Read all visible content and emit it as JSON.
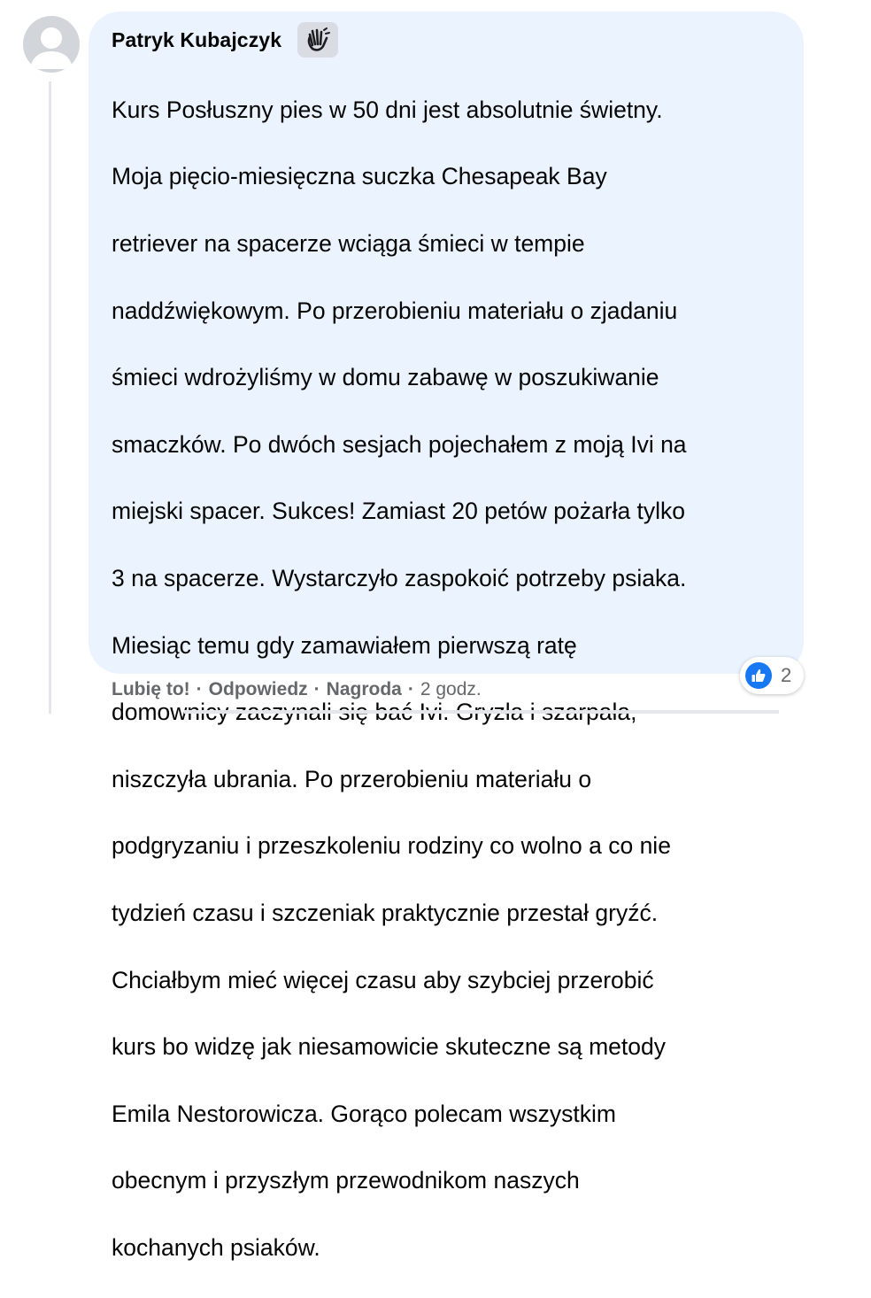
{
  "comment": {
    "author": "Patryk Kubajczyk",
    "badge_icon": "waving-hand-icon",
    "lines": [
      "Kurs Posłuszny pies w 50 dni jest absolutnie świetny.",
      "Moja pięcio-miesięczna suczka Chesapeak Bay",
      "retriever na spacerze wciąga śmieci w tempie",
      "naddźwiękowym. Po przerobieniu materiału o zjadaniu",
      "śmieci wdrożyliśmy w domu zabawę w poszukiwanie",
      "smaczków. Po dwóch sesjach pojechałem z moją Ivi na",
      "miejski spacer. Sukces! Zamiast 20 petów pożarła tylko",
      "3 na spacerze. Wystarczyło zaspokoić potrzeby psiaka.",
      "Miesiąc temu gdy zamawiałem pierwszą ratę",
      "domownicy zaczynali się bać Ivi. Gryzła i szarpała,",
      "niszczyła ubrania. Po przerobieniu materiału o",
      "podgryzaniu i przeszkoleniu rodziny co wolno a co nie",
      "tydzień czasu i szczeniak praktycznie przestał gryźć.",
      "Chciałbym mieć więcej czasu aby szybciej przerobić",
      "kurs bo widzę jak niesamowicie skuteczne są metody",
      "Emila Nestorowicza. Gorąco polecam wszystkim",
      "obecnym i przyszłym przewodnikom naszych",
      "kochanych psiaków."
    ],
    "actions": {
      "like": "Lubię to!",
      "reply": "Odpowiedz",
      "award": "Nagroda",
      "separator": "·",
      "time": "2 godz."
    },
    "reactions": {
      "icon": "thumbs-up-icon",
      "count": "2"
    },
    "colors": {
      "bubble": "#eaf3fe",
      "meta_text": "#65676b",
      "like_blue": "#1877f2"
    }
  }
}
